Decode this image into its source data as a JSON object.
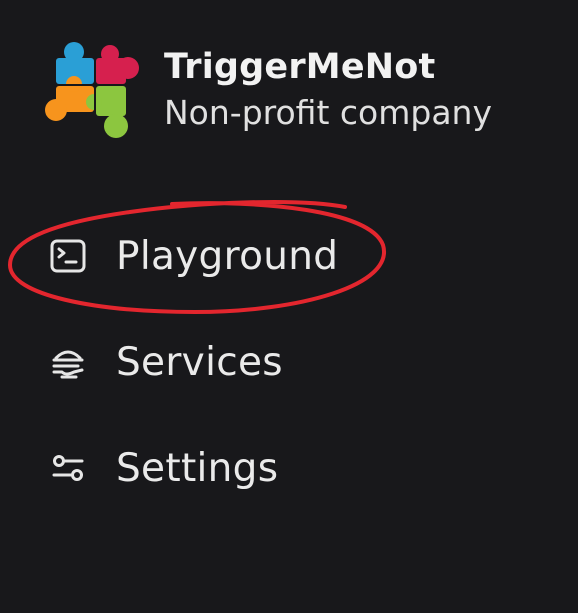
{
  "brand": {
    "name": "TriggerMeNot",
    "subtitle": "Non-profit company",
    "logo_icon": "puzzle-pieces-logo",
    "logo_colors": [
      "#2a9fd6",
      "#d6204e",
      "#f7941d",
      "#8cc63f"
    ]
  },
  "nav": {
    "items": [
      {
        "label": "Playground",
        "icon": "terminal-icon"
      },
      {
        "label": "Services",
        "icon": "services-icon"
      },
      {
        "label": "Settings",
        "icon": "sliders-icon"
      }
    ]
  },
  "annotation": {
    "shape": "hand-drawn-ellipse",
    "color": "#e3262e",
    "target": "Playground"
  }
}
